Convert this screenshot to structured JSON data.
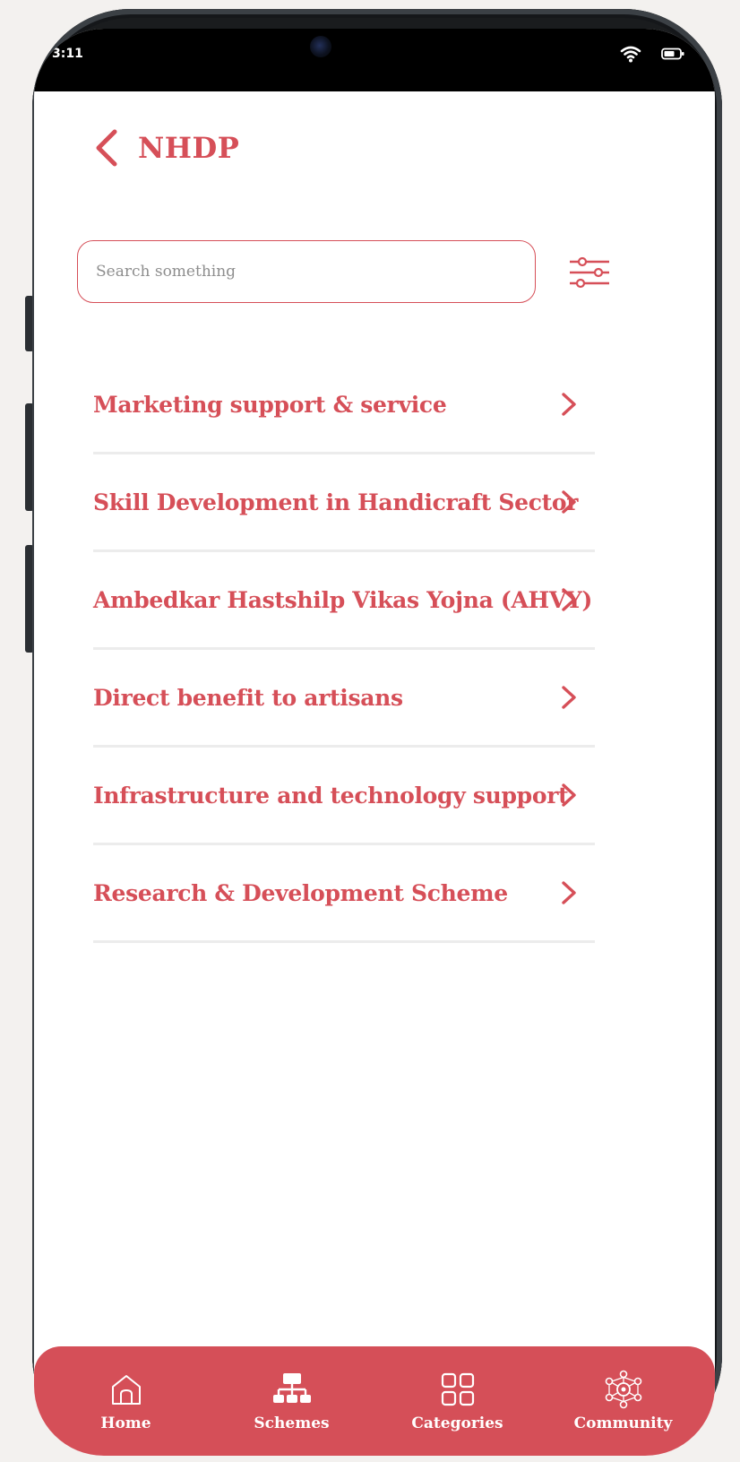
{
  "status_bar": {
    "time": "3:11"
  },
  "header": {
    "title": "NHDP"
  },
  "search": {
    "placeholder": "Search something"
  },
  "schemes": [
    {
      "label": "Marketing support & service"
    },
    {
      "label": "Skill Development in Handicraft Sector"
    },
    {
      "label": "Ambedkar Hastshilp Vikas Yojna (AHVY)"
    },
    {
      "label": "Direct benefit to artisans"
    },
    {
      "label": "Infrastructure and technology support"
    },
    {
      "label": "Research & Development Scheme"
    }
  ],
  "bottom_nav": [
    {
      "label": "Home",
      "icon": "home-icon"
    },
    {
      "label": "Schemes",
      "icon": "hierarchy-icon"
    },
    {
      "label": "Categories",
      "icon": "grid-icon"
    },
    {
      "label": "Community",
      "icon": "network-icon"
    }
  ],
  "colors": {
    "accent": "#d64f58",
    "nav_background": "#d54f58",
    "divider": "#ececec"
  }
}
